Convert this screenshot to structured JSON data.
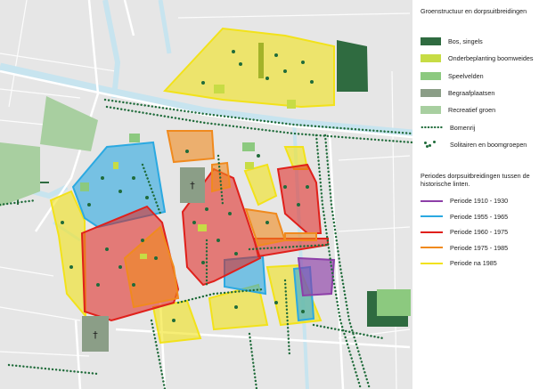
{
  "legend": {
    "title": "Groenstructuur en dorpsuitbreidingen",
    "items": [
      {
        "label": "Bos, singels",
        "color": "#2f6b40",
        "kind": "box"
      },
      {
        "label": "Onderbeplanting boomweides",
        "color": "#c7dc45",
        "kind": "box"
      },
      {
        "label": "Speelvelden",
        "color": "#8cc97f",
        "kind": "box"
      },
      {
        "label": "Begraafplaatsen",
        "color": "#8b9e87",
        "kind": "box"
      },
      {
        "label": "Recreatief groen",
        "color": "#a8cfa0",
        "kind": "box"
      },
      {
        "label": "Bomenrij",
        "color": "#1f6b3a",
        "kind": "dots"
      },
      {
        "label": "Solitairen en boomgroepen",
        "color": "#1f6b3a",
        "kind": "solitary"
      }
    ],
    "periods_title": "Periodes dorpsuitbreidingen tussen de historische linten.",
    "periods": [
      {
        "label": "Periode 1910 - 1930",
        "color": "#8d3fa8"
      },
      {
        "label": "Periode 1955 - 1965",
        "color": "#2ba9e1"
      },
      {
        "label": "Periode 1960 - 1975",
        "color": "#e0201b"
      },
      {
        "label": "Periode 1975 - 1985",
        "color": "#f08a1e"
      },
      {
        "label": "Periode na 1985",
        "color": "#f2e21a"
      }
    ]
  },
  "map": {
    "cemetery_symbol": "†",
    "colors": {
      "background": "#e6e6e6",
      "road": "#c7e4ef",
      "building": "#d8b8a8",
      "bos": "#2f6b40",
      "onderbeplanting": "#c7dc45",
      "speelvelden": "#8cc97f",
      "begraaf": "#8b9e87",
      "recreatief": "#a8cfa0",
      "p1910": "#8d3fa8",
      "p1955": "#2ba9e1",
      "p1960": "#e0201b",
      "p1975": "#f08a1e",
      "p1985": "#f2e21a"
    }
  }
}
